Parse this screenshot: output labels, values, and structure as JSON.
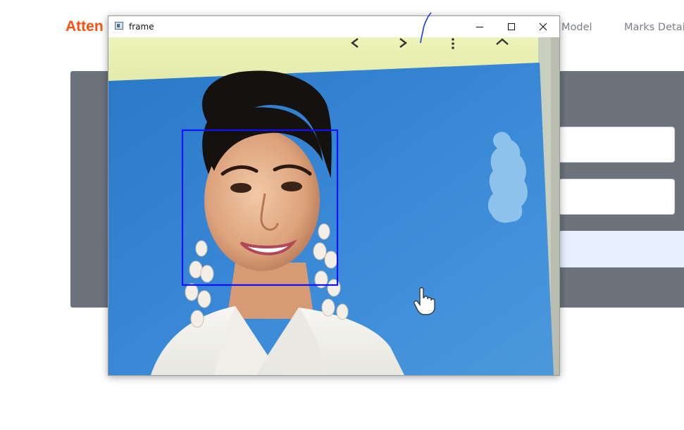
{
  "background_page": {
    "brand_text": "Atten",
    "nav": {
      "model_label": "Model",
      "marks_label": "Marks Detail"
    }
  },
  "window": {
    "title": "frame",
    "controls": [
      "minimize",
      "maximize",
      "close"
    ]
  },
  "camera_frame": {
    "face_detections": 1,
    "detection_box_color": "#1010ff"
  },
  "colors": {
    "brand": "#ff4f0f",
    "panel": "#6c737d",
    "nav_text": "#7a7f86",
    "screen_blue": "#2f7fd0"
  },
  "icons": [
    "frame-app-icon",
    "minimize-icon",
    "maximize-icon",
    "close-icon",
    "chevron-left-icon",
    "chevron-right-icon",
    "more-vert-icon",
    "chevron-up-icon",
    "hand-cursor-icon"
  ]
}
